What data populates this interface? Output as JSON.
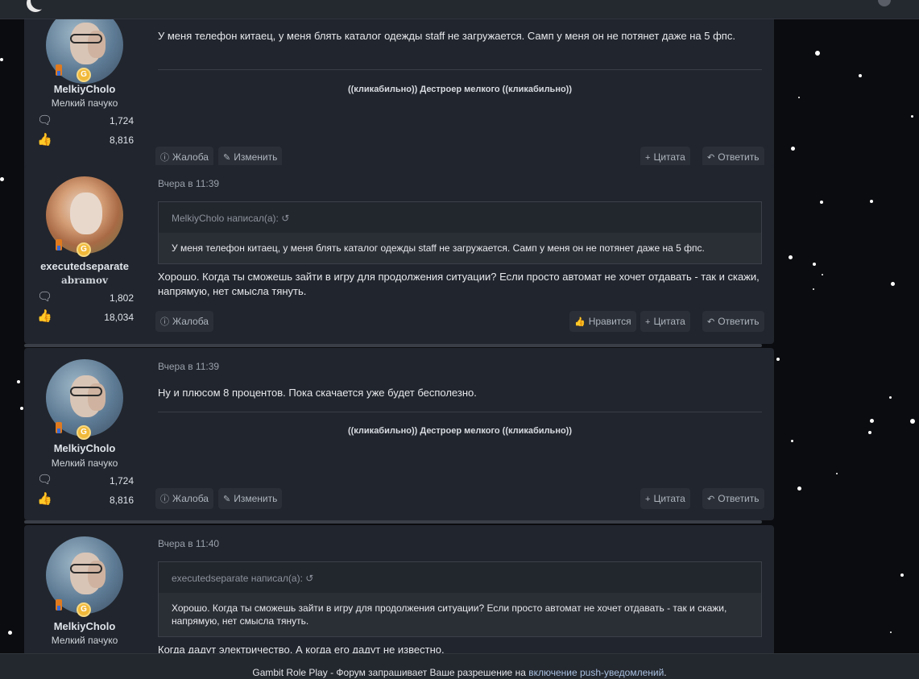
{
  "topbar": {},
  "posts": [
    {
      "username": "MelkiyCholo",
      "user_title": "Мелкий пачуко",
      "messages": "1,724",
      "likes": "8,816",
      "text": "У меня телефон китаец, у меня блять каталог одежды staff не загружается. Самп у меня он не потянет даже на 5 фпс.",
      "signature": "((кликабильно)) Дестроер мелкого ((кликабильно))",
      "actions_left": [
        "Жалоба",
        "Изменить"
      ],
      "actions_right": [
        "Цитата",
        "Ответить"
      ]
    },
    {
      "username": "executedseparate",
      "user_title": "abramov",
      "messages": "1,802",
      "likes": "18,034",
      "date": "Вчера в 11:39",
      "quote_author": "MelkiyCholo написал(а):",
      "quote_text": "У меня телефон китаец, у меня блять каталог одежды staff не загружается. Самп у меня он не потянет даже на 5 фпс.",
      "text": "Хорошо. Когда ты сможешь зайти в игру для продолжения ситуации? Если просто автомат не хочет отдавать - так и скажи, напрямую, нет смысла тянуть.",
      "actions_left": [
        "Жалоба"
      ],
      "actions_right": [
        "Нравится",
        "Цитата",
        "Ответить"
      ]
    },
    {
      "username": "MelkiyCholo",
      "user_title": "Мелкий пачуко",
      "messages": "1,724",
      "likes": "8,816",
      "date": "Вчера в 11:39",
      "text": "Ну и плюсом 8 процентов. Пока скачается уже будет бесполезно.",
      "signature": "((кликабильно)) Дестроер мелкого ((кликабильно))",
      "actions_left": [
        "Жалоба",
        "Изменить"
      ],
      "actions_right": [
        "Цитата",
        "Ответить"
      ]
    },
    {
      "username": "MelkiyCholo",
      "user_title": "Мелкий пачуко",
      "date": "Вчера в 11:40",
      "quote_author": "executedseparate написал(а):",
      "quote_text": "Хорошо. Когда ты сможешь зайти в игру для продолжения ситуации? Если просто автомат не хочет отдавать - так и скажи, напрямую, нет смысла тянуть.",
      "text": "Когда дадут электричество. А когда его дадут не известно."
    }
  ],
  "push_bar": {
    "prefix": "Gambit Role Play - Форум запрашивает Ваше разрешение на",
    "link": "включение push-уведомлений",
    "suffix": "."
  }
}
